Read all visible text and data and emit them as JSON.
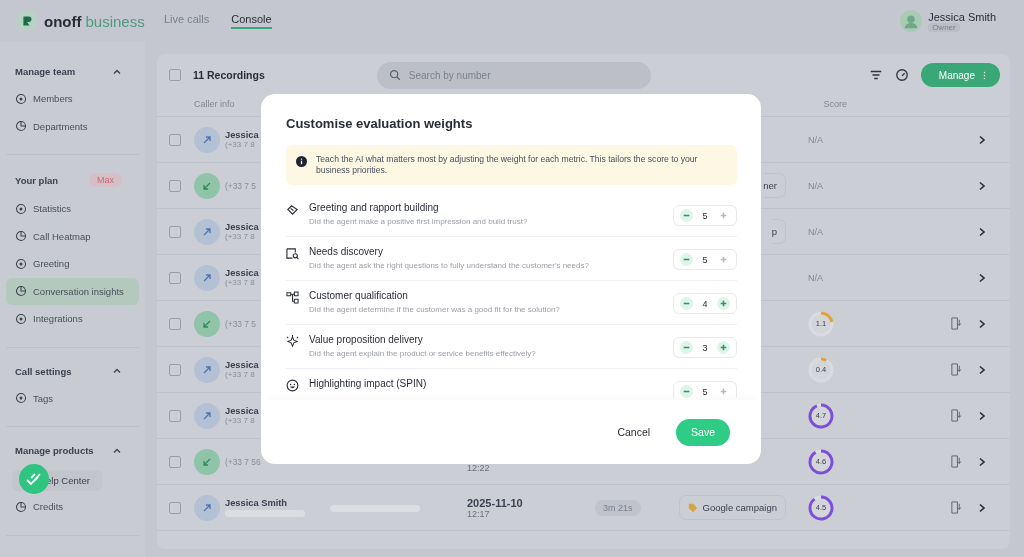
{
  "brand": {
    "name": "onoff",
    "suffix": "business"
  },
  "nav": [
    {
      "label": "Live calls",
      "selected": false
    },
    {
      "label": "Console",
      "selected": true
    }
  ],
  "user": {
    "name": "Jessica Smith",
    "role": "Owner"
  },
  "sidebar": [
    {
      "title": "Manage team",
      "expanded": true,
      "items": [
        {
          "label": "Members",
          "selected": false
        },
        {
          "label": "Departments",
          "selected": false
        }
      ]
    },
    {
      "title": "Your plan",
      "badge": "Max",
      "items": [
        {
          "label": "Statistics",
          "selected": false
        },
        {
          "label": "Call Heatmap",
          "selected": false
        },
        {
          "label": "Greeting",
          "selected": false
        },
        {
          "label": "Conversation insights",
          "selected": true
        },
        {
          "label": "Integrations",
          "selected": false
        }
      ]
    },
    {
      "title": "Call settings",
      "expanded": true,
      "items": [
        {
          "label": "Tags",
          "selected": false
        }
      ]
    },
    {
      "title": "Manage products",
      "expanded": true,
      "items": [
        {
          "label": "elp Center",
          "selected": false,
          "kind": "help"
        },
        {
          "label": "Credits",
          "selected": false
        }
      ]
    }
  ],
  "toolbar": {
    "select_all": false,
    "count": "11 Recordings",
    "search": {
      "placeholder": "Search by number"
    },
    "manage": "Manage"
  },
  "table": {
    "columns": [
      "Caller info",
      "Score"
    ],
    "rows": [
      {
        "kind": "outgoing",
        "checked": false,
        "name": "Jessica",
        "number": "(+33 7 8",
        "score": "N/A",
        "download": false
      },
      {
        "kind": "incoming",
        "checked": false,
        "number": "(+33 7 5",
        "tag": "ner",
        "tag_icon": false,
        "score": "N/A",
        "download": false
      },
      {
        "kind": "outgoing",
        "checked": false,
        "name": "Jessica",
        "number": "(+33 7 8",
        "tag": "p",
        "tag_icon": false,
        "score": "N/A",
        "download": false
      },
      {
        "kind": "outgoing",
        "checked": false,
        "name": "Jessica",
        "number": "(+33 7 8",
        "score": "N/A",
        "download": false
      },
      {
        "kind": "incoming",
        "checked": false,
        "number": "(+33 7 5",
        "score": "1.1",
        "color": "#e0a23c",
        "download": true
      },
      {
        "kind": "outgoing",
        "checked": false,
        "name": "Jessica",
        "number": "(+33 7 8",
        "score": "0.4",
        "color": "#e0a23c",
        "download": true
      },
      {
        "kind": "outgoing",
        "checked": false,
        "name": "Jessica",
        "number": "(+33 7 8",
        "score": "4.7",
        "color": "#7b4fd6",
        "download": true
      },
      {
        "kind": "incoming",
        "checked": false,
        "number": "(+33 7 56",
        "time": "12:22",
        "score": "4.6",
        "color": "#7b4fd6",
        "download": true
      },
      {
        "kind": "outgoing",
        "checked": false,
        "name": "Jessica Smith",
        "redacted": true,
        "date": "2025-11-10",
        "time": "12:17",
        "duration": "3m 21s",
        "tag": "Google campaign",
        "tag_icon": true,
        "score": "4.5",
        "color": "#7b4fd6",
        "download": true
      }
    ]
  },
  "dialog": {
    "title": "Customise evaluation weights",
    "info": "Teach the AI what matters most by adjusting the weight for each metric. This tailors the score to your business priorities.",
    "metrics": [
      {
        "name": "Greeting and rapport building",
        "description": "Did the agent make a positive first impression and build trust?",
        "value": "5",
        "can_increase": false
      },
      {
        "name": "Needs discovery",
        "description": "Did the agent ask the right questions to fully understand the customer's needs?",
        "value": "5",
        "can_increase": false
      },
      {
        "name": "Customer qualification",
        "description": "Did the agent determine if the customer was a good fit for the solution?",
        "value": "4",
        "can_increase": true
      },
      {
        "name": "Value proposition delivery",
        "description": "Did the agent explain the product or service benefits effectively?",
        "value": "3",
        "can_increase": true
      },
      {
        "name": "Highlighting impact (SPIN)",
        "value": "5",
        "can_increase": false
      }
    ],
    "cancel": "Cancel",
    "save": "Save"
  }
}
